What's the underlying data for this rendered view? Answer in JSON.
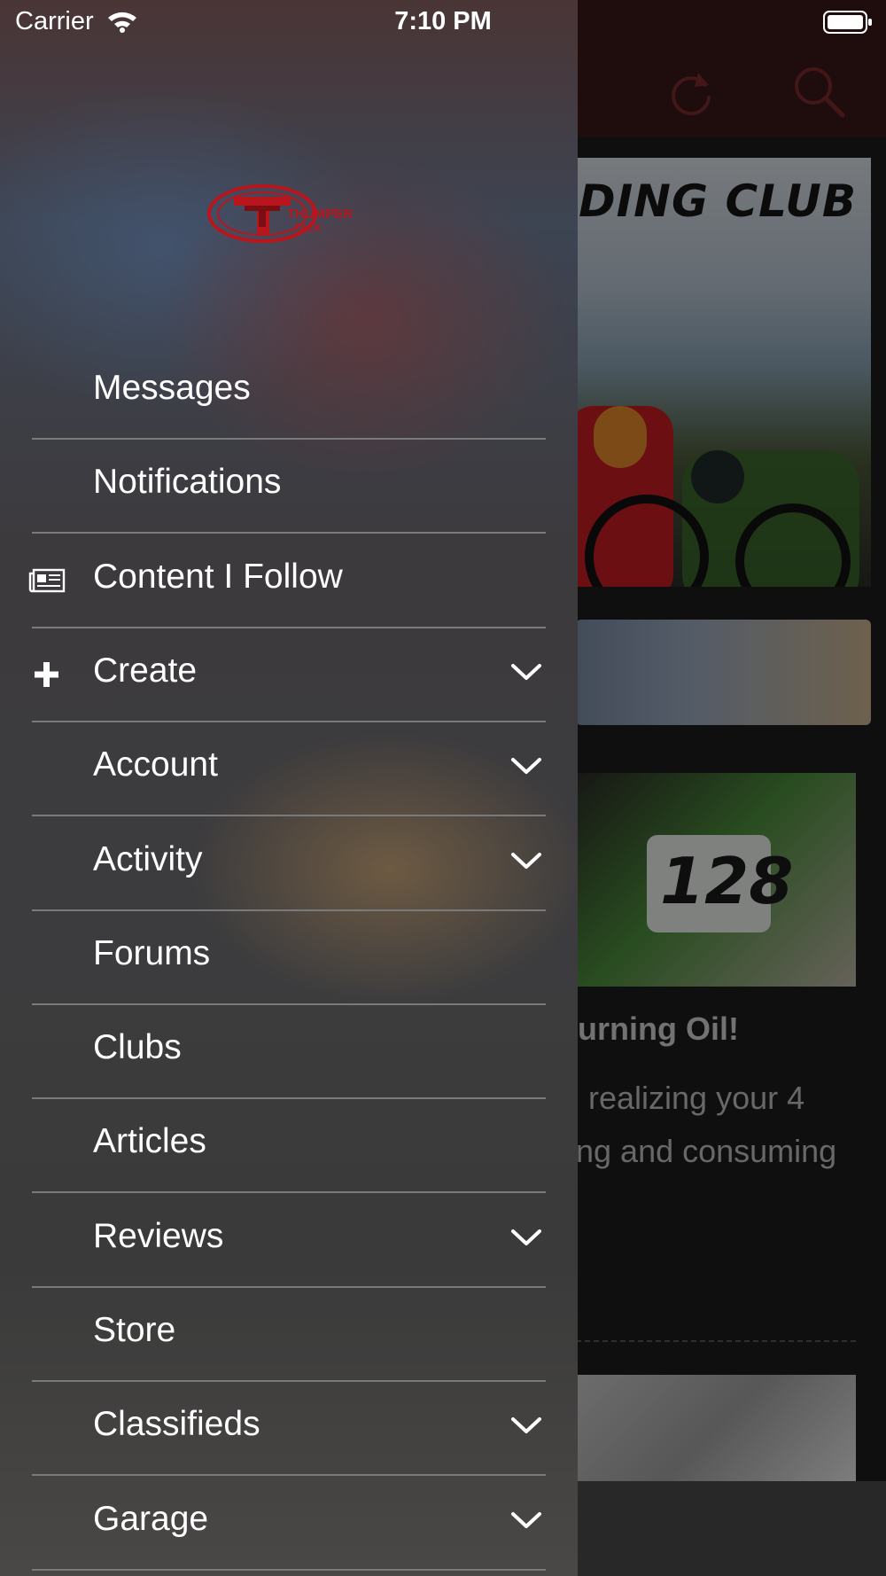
{
  "status_bar": {
    "carrier": "Carrier",
    "time": "7:10 PM",
    "wifi_icon": "wifi-icon",
    "battery_icon": "battery-icon"
  },
  "background_app": {
    "header": {
      "refresh_icon": "refresh-icon",
      "search_icon": "search-icon",
      "accent_color": "#c0392b"
    },
    "banner_text": "DING CLUB",
    "bike_number": "128",
    "article_title": "urning Oil!",
    "article_snippet": [
      "realizing your 4",
      "ng and consuming"
    ]
  },
  "drawer": {
    "logo_icon": "thumper-talk-logo",
    "menu": [
      {
        "label": "Messages",
        "icon": null,
        "expandable": false
      },
      {
        "label": "Notifications",
        "icon": null,
        "expandable": false
      },
      {
        "label": "Content I Follow",
        "icon": "newspaper-icon",
        "expandable": false
      },
      {
        "label": "Create",
        "icon": "plus-icon",
        "expandable": true
      },
      {
        "label": "Account",
        "icon": null,
        "expandable": true
      },
      {
        "label": "Activity",
        "icon": null,
        "expandable": true
      },
      {
        "label": "Forums",
        "icon": null,
        "expandable": false
      },
      {
        "label": "Clubs",
        "icon": null,
        "expandable": false
      },
      {
        "label": "Articles",
        "icon": null,
        "expandable": false
      },
      {
        "label": "Reviews",
        "icon": null,
        "expandable": true
      },
      {
        "label": "Store",
        "icon": null,
        "expandable": false
      },
      {
        "label": "Classifieds",
        "icon": null,
        "expandable": true
      },
      {
        "label": "Garage",
        "icon": null,
        "expandable": true
      }
    ]
  }
}
